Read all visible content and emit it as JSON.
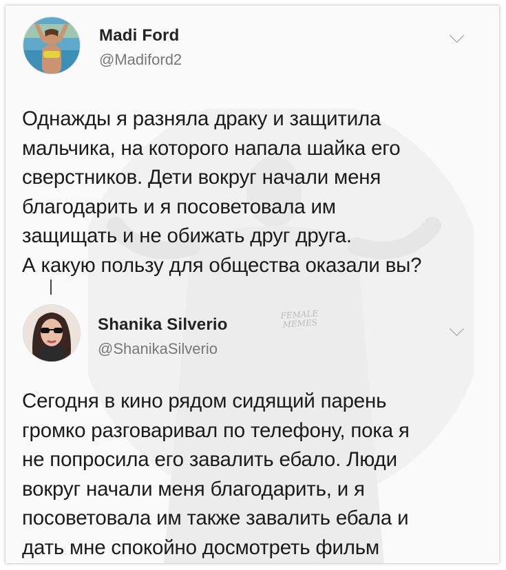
{
  "tweets": [
    {
      "author_name": "Madi Ford",
      "author_handle": "@Madiford2",
      "text": "Однажды я разняла драку и защитила\nмальчика, на которого напала шайка его\nсверстников. Дети вокруг начали меня\nблагодарить и я посоветовала им\nзащищать и не обижать друг друга.\nА какую пользу для общества оказали вы?",
      "menu_icon": "chevron-down-icon"
    },
    {
      "author_name": "Shanika Silverio",
      "author_handle": "@ShanikaSilverio",
      "text": "Сегодня в кино рядом сидящий парень\nгромко разговаривал по телефону, пока я\nне попросила его завалить ебало. Люди\nвокруг начали меня благодарить, и я\nпосоветовала им также завалить ебала и\nдать мне спокойно досмотреть фильм",
      "menu_icon": "chevron-down-icon"
    }
  ],
  "watermark": "FEMALE\nMEMES"
}
